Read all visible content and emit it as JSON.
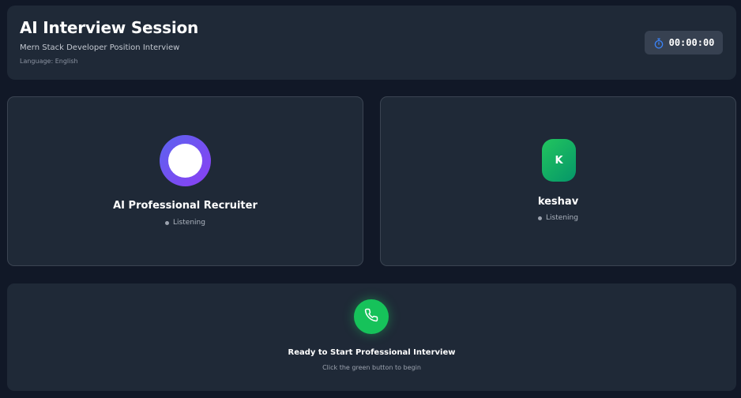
{
  "header": {
    "title": "AI Interview Session",
    "subtitle": "Mern Stack Developer Position Interview",
    "language": "Language: English",
    "timer": "00:00:00",
    "timer_icon": "stopwatch-icon",
    "accent_color": "#3b82f6"
  },
  "ai_participant": {
    "name": "AI Professional Recruiter",
    "status": "Listening"
  },
  "user_participant": {
    "initial": "K",
    "name": "keshav",
    "status": "Listening"
  },
  "controls": {
    "call_icon": "phone-icon",
    "call_button_color": "#16c25a",
    "ready_text": "Ready to Start Professional Interview",
    "hint_text": "Click the green button to begin"
  }
}
